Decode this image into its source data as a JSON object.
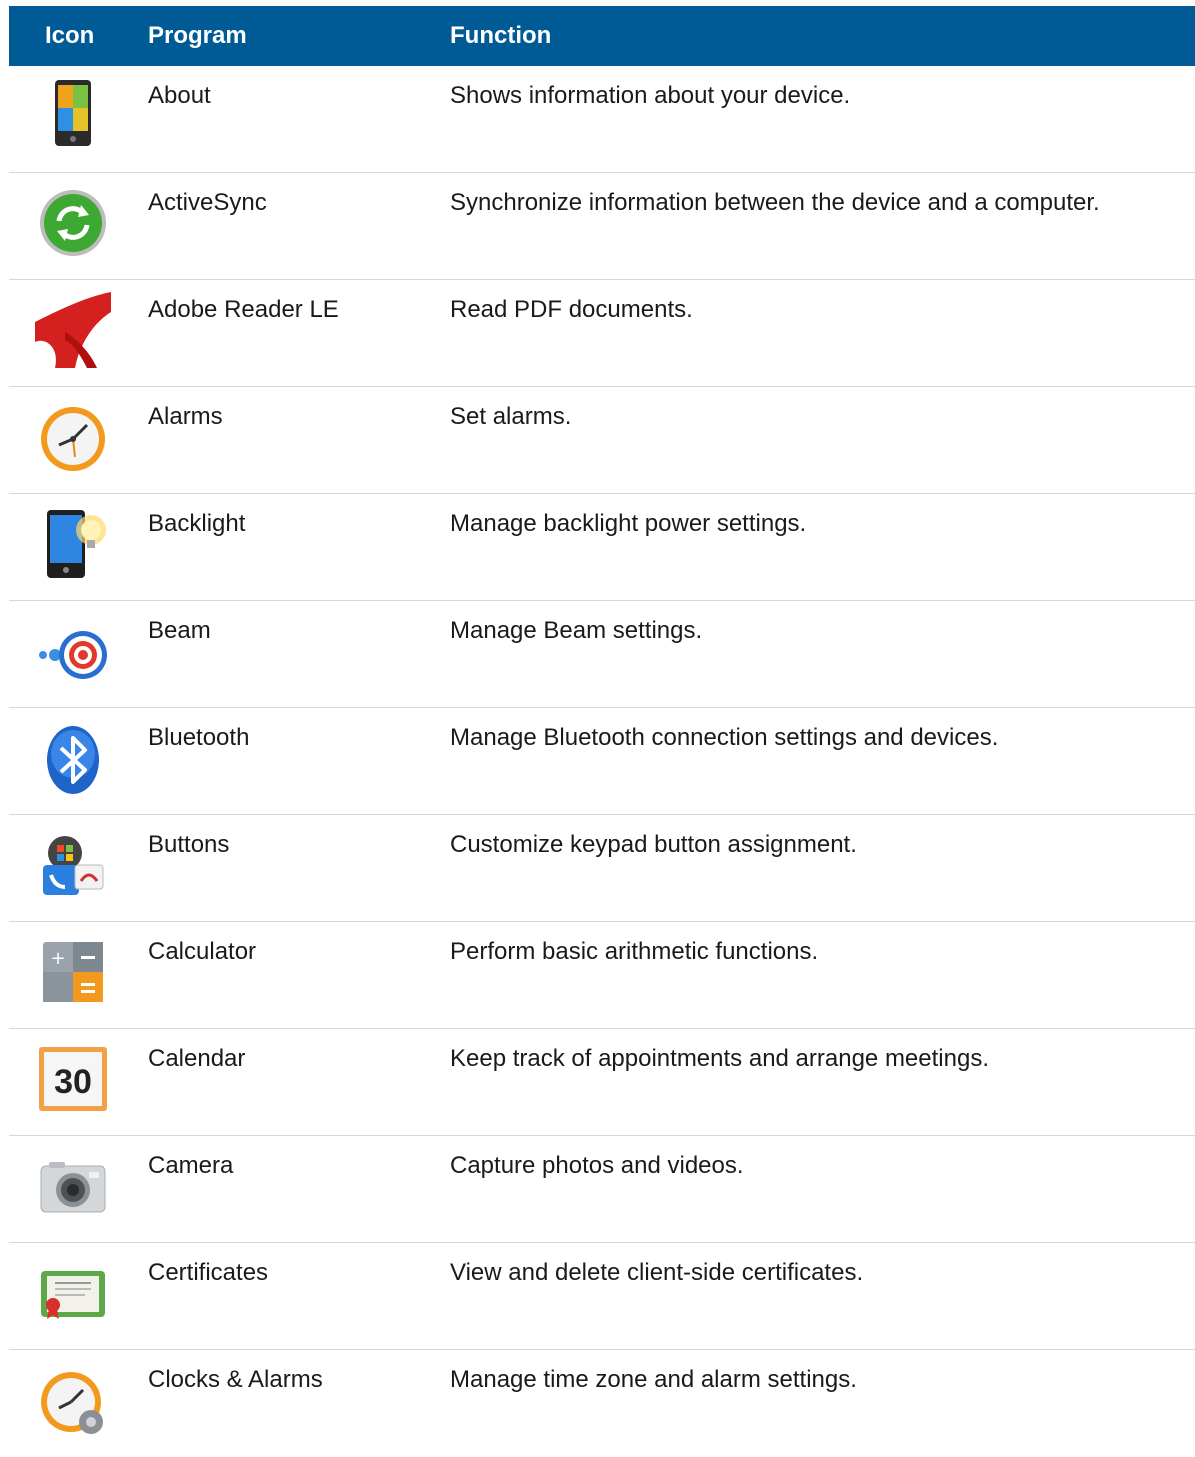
{
  "table": {
    "headers": {
      "icon": "Icon",
      "program": "Program",
      "function": "Function"
    },
    "header_color": "#005a96",
    "rows": [
      {
        "icon": "about-icon",
        "program": "About",
        "function": "Shows information about your device."
      },
      {
        "icon": "activesync-icon",
        "program": "ActiveSync",
        "function": "Synchronize information between the device and a computer."
      },
      {
        "icon": "adobe-reader-icon",
        "program": "Adobe Reader LE",
        "function": "Read PDF documents."
      },
      {
        "icon": "alarms-icon",
        "program": "Alarms",
        "function": "Set alarms."
      },
      {
        "icon": "backlight-icon",
        "program": "Backlight",
        "function": "Manage backlight power settings."
      },
      {
        "icon": "beam-icon",
        "program": "Beam",
        "function": "Manage Beam settings."
      },
      {
        "icon": "bluetooth-icon",
        "program": "Bluetooth",
        "function": "Manage Bluetooth connection settings and devices."
      },
      {
        "icon": "buttons-icon",
        "program": "Buttons",
        "function": "Customize keypad button assignment."
      },
      {
        "icon": "calculator-icon",
        "program": "Calculator",
        "function": "Perform basic arithmetic functions."
      },
      {
        "icon": "calendar-icon",
        "program": "Calendar",
        "function": "Keep track of appointments and arrange meetings.",
        "icon_text": "30"
      },
      {
        "icon": "camera-icon",
        "program": "Camera",
        "function": "Capture photos and videos."
      },
      {
        "icon": "certificates-icon",
        "program": "Certificates",
        "function": "View and delete client-side certificates."
      },
      {
        "icon": "clocks-alarms-icon",
        "program": "Clocks & Alarms",
        "function": "Manage time zone and alarm settings."
      }
    ]
  }
}
